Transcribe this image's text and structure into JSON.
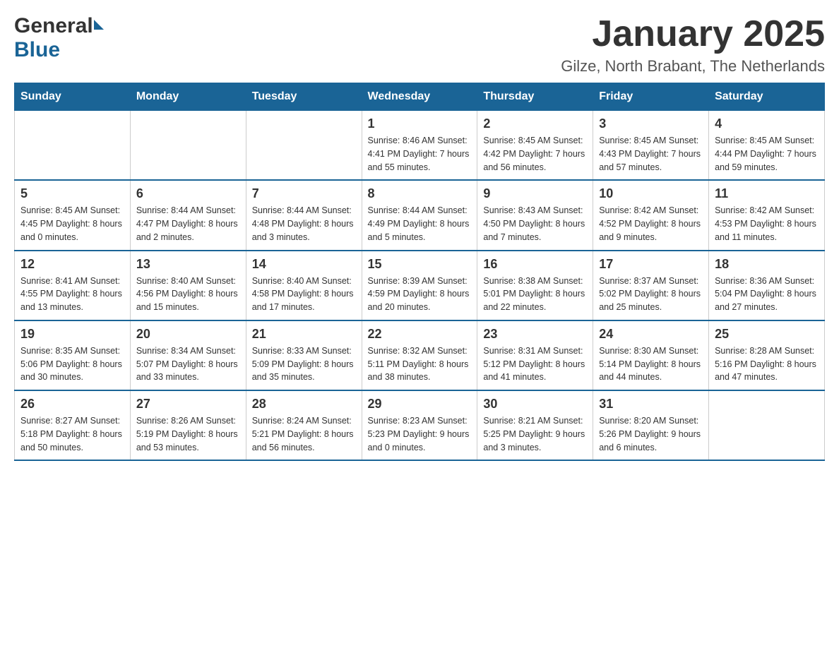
{
  "header": {
    "logo_general": "General",
    "logo_blue": "Blue",
    "month_title": "January 2025",
    "location": "Gilze, North Brabant, The Netherlands"
  },
  "weekdays": [
    "Sunday",
    "Monday",
    "Tuesday",
    "Wednesday",
    "Thursday",
    "Friday",
    "Saturday"
  ],
  "weeks": [
    [
      {
        "day": "",
        "info": ""
      },
      {
        "day": "",
        "info": ""
      },
      {
        "day": "",
        "info": ""
      },
      {
        "day": "1",
        "info": "Sunrise: 8:46 AM\nSunset: 4:41 PM\nDaylight: 7 hours and 55 minutes."
      },
      {
        "day": "2",
        "info": "Sunrise: 8:45 AM\nSunset: 4:42 PM\nDaylight: 7 hours and 56 minutes."
      },
      {
        "day": "3",
        "info": "Sunrise: 8:45 AM\nSunset: 4:43 PM\nDaylight: 7 hours and 57 minutes."
      },
      {
        "day": "4",
        "info": "Sunrise: 8:45 AM\nSunset: 4:44 PM\nDaylight: 7 hours and 59 minutes."
      }
    ],
    [
      {
        "day": "5",
        "info": "Sunrise: 8:45 AM\nSunset: 4:45 PM\nDaylight: 8 hours and 0 minutes."
      },
      {
        "day": "6",
        "info": "Sunrise: 8:44 AM\nSunset: 4:47 PM\nDaylight: 8 hours and 2 minutes."
      },
      {
        "day": "7",
        "info": "Sunrise: 8:44 AM\nSunset: 4:48 PM\nDaylight: 8 hours and 3 minutes."
      },
      {
        "day": "8",
        "info": "Sunrise: 8:44 AM\nSunset: 4:49 PM\nDaylight: 8 hours and 5 minutes."
      },
      {
        "day": "9",
        "info": "Sunrise: 8:43 AM\nSunset: 4:50 PM\nDaylight: 8 hours and 7 minutes."
      },
      {
        "day": "10",
        "info": "Sunrise: 8:42 AM\nSunset: 4:52 PM\nDaylight: 8 hours and 9 minutes."
      },
      {
        "day": "11",
        "info": "Sunrise: 8:42 AM\nSunset: 4:53 PM\nDaylight: 8 hours and 11 minutes."
      }
    ],
    [
      {
        "day": "12",
        "info": "Sunrise: 8:41 AM\nSunset: 4:55 PM\nDaylight: 8 hours and 13 minutes."
      },
      {
        "day": "13",
        "info": "Sunrise: 8:40 AM\nSunset: 4:56 PM\nDaylight: 8 hours and 15 minutes."
      },
      {
        "day": "14",
        "info": "Sunrise: 8:40 AM\nSunset: 4:58 PM\nDaylight: 8 hours and 17 minutes."
      },
      {
        "day": "15",
        "info": "Sunrise: 8:39 AM\nSunset: 4:59 PM\nDaylight: 8 hours and 20 minutes."
      },
      {
        "day": "16",
        "info": "Sunrise: 8:38 AM\nSunset: 5:01 PM\nDaylight: 8 hours and 22 minutes."
      },
      {
        "day": "17",
        "info": "Sunrise: 8:37 AM\nSunset: 5:02 PM\nDaylight: 8 hours and 25 minutes."
      },
      {
        "day": "18",
        "info": "Sunrise: 8:36 AM\nSunset: 5:04 PM\nDaylight: 8 hours and 27 minutes."
      }
    ],
    [
      {
        "day": "19",
        "info": "Sunrise: 8:35 AM\nSunset: 5:06 PM\nDaylight: 8 hours and 30 minutes."
      },
      {
        "day": "20",
        "info": "Sunrise: 8:34 AM\nSunset: 5:07 PM\nDaylight: 8 hours and 33 minutes."
      },
      {
        "day": "21",
        "info": "Sunrise: 8:33 AM\nSunset: 5:09 PM\nDaylight: 8 hours and 35 minutes."
      },
      {
        "day": "22",
        "info": "Sunrise: 8:32 AM\nSunset: 5:11 PM\nDaylight: 8 hours and 38 minutes."
      },
      {
        "day": "23",
        "info": "Sunrise: 8:31 AM\nSunset: 5:12 PM\nDaylight: 8 hours and 41 minutes."
      },
      {
        "day": "24",
        "info": "Sunrise: 8:30 AM\nSunset: 5:14 PM\nDaylight: 8 hours and 44 minutes."
      },
      {
        "day": "25",
        "info": "Sunrise: 8:28 AM\nSunset: 5:16 PM\nDaylight: 8 hours and 47 minutes."
      }
    ],
    [
      {
        "day": "26",
        "info": "Sunrise: 8:27 AM\nSunset: 5:18 PM\nDaylight: 8 hours and 50 minutes."
      },
      {
        "day": "27",
        "info": "Sunrise: 8:26 AM\nSunset: 5:19 PM\nDaylight: 8 hours and 53 minutes."
      },
      {
        "day": "28",
        "info": "Sunrise: 8:24 AM\nSunset: 5:21 PM\nDaylight: 8 hours and 56 minutes."
      },
      {
        "day": "29",
        "info": "Sunrise: 8:23 AM\nSunset: 5:23 PM\nDaylight: 9 hours and 0 minutes."
      },
      {
        "day": "30",
        "info": "Sunrise: 8:21 AM\nSunset: 5:25 PM\nDaylight: 9 hours and 3 minutes."
      },
      {
        "day": "31",
        "info": "Sunrise: 8:20 AM\nSunset: 5:26 PM\nDaylight: 9 hours and 6 minutes."
      },
      {
        "day": "",
        "info": ""
      }
    ]
  ]
}
